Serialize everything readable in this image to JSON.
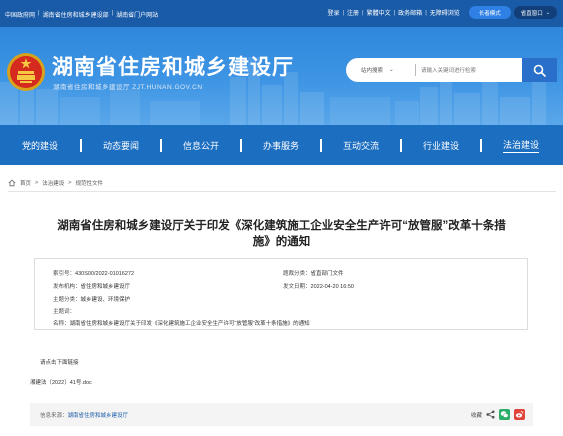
{
  "topbar": {
    "links": [
      "中国政府网",
      "湖南省住房和城乡建设部",
      "湖南省门户网站"
    ],
    "right_links": [
      "登录",
      "注册",
      "繁體中文",
      "政务邮箱",
      "无障碍浏览"
    ],
    "care_mode": "长者模式",
    "province_dropdown": "省直窗口"
  },
  "header": {
    "title": "湖南省住房和城乡建设厅",
    "domain": "湖南省住房和城乡建设厅  ZJT.HUNAN.GOV.CN",
    "search_scope": "站内搜索",
    "search_placeholder": "请输入关键词进行检索"
  },
  "nav": {
    "items": [
      "党的建设",
      "动态要闻",
      "信息公开",
      "办事服务",
      "互动交流",
      "行业建设",
      "法治建设"
    ]
  },
  "breadcrumb": {
    "items": [
      "首页",
      "法治建设",
      "规范性文件"
    ]
  },
  "article": {
    "title_line1": "湖南省住房和城乡建设厅关于印发《深化建筑施工企业安全生产许可“放管服”改革十条措",
    "title_line2": "施》的通知",
    "meta": {
      "index_label": "索引号：",
      "index": "430S00/2022-01016272",
      "category_label": "题裁分类：",
      "category": "省直部门文件",
      "publisher_label": "发布机构：",
      "publisher": "省住房和城乡建设厅",
      "date_label": "发文日期：",
      "date": "2022-04-20 16:50",
      "topic_label": "主题分类：",
      "topic": "城乡建设、环境保护",
      "keywords_label": "主题词：",
      "keywords": "",
      "name_label": "名称：",
      "name": "湖南省住房和城乡建设厅关于印发《深化建筑施工企业安全生产许可“放管服”改革十条措施》的通知"
    },
    "pre_link": "请点击下面链接",
    "attachment": "湘建法〔2022〕41号.doc"
  },
  "footer": {
    "source_label": "信息来源：",
    "source": "湖南省住房和城乡建设厅",
    "favorite": "收藏"
  },
  "colors": {
    "topbar": "#1a5ba8",
    "nav": "#1c6ec1",
    "header_blue": "#3e95e4",
    "wechat": "#2aae67",
    "weibo": "#e0433a"
  }
}
